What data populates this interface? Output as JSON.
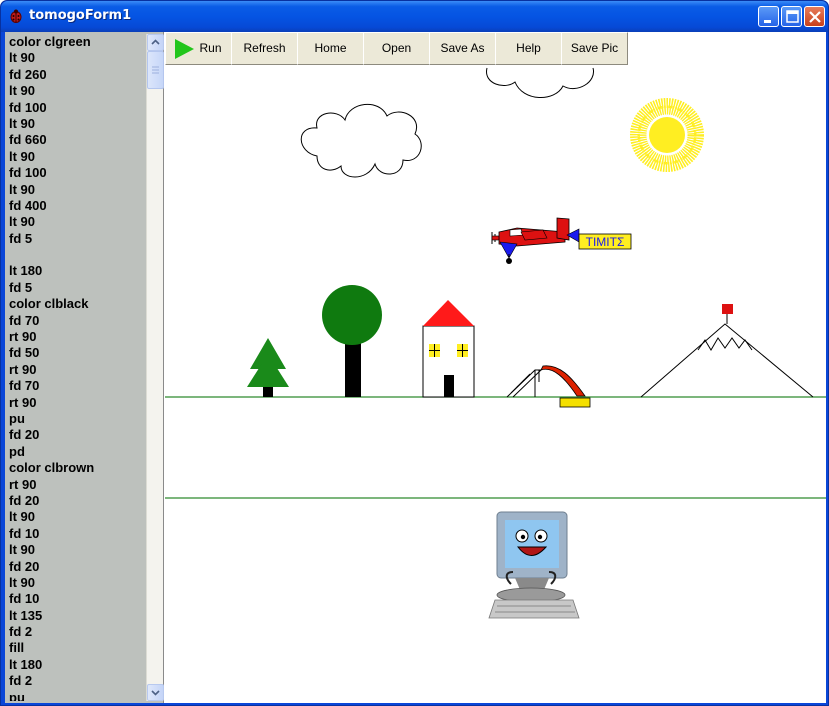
{
  "window": {
    "title": "tomogoForm1"
  },
  "code_lines": [
    "color clgreen",
    "lt 90",
    "fd 260",
    "lt 90",
    "fd 100",
    "lt 90",
    "fd 660",
    "lt 90",
    "fd 100",
    "lt 90",
    "fd 400",
    "lt 90",
    "fd 5",
    "",
    "lt 180",
    "fd 5",
    "color clblack",
    "fd 70",
    "rt 90",
    "fd 50",
    "rt 90",
    "fd 70",
    "rt 90",
    "pu",
    "fd 20",
    "pd",
    "color clbrown",
    "rt 90",
    "fd 20",
    "lt 90",
    "fd 10",
    "lt 90",
    "fd 20",
    "lt 90",
    "fd 10",
    "lt 135",
    "fd 2",
    "fill",
    "lt 180",
    "fd 2",
    "pu"
  ],
  "toolbar": {
    "run": "Run",
    "refresh": "Refresh",
    "home": "Home",
    "open": "Open",
    "save_as": "Save As",
    "help": "Help",
    "save_pic": "Save Pic"
  },
  "canvas": {
    "airplane_banner": "TIMITΣ"
  },
  "colors": {
    "ground_line": "#2e8b2e",
    "tree_green": "#1a8a1a",
    "round_tree": "#0f7a0f",
    "roof_red": "#ff1a1a",
    "sun_yellow": "#ffee22",
    "slide_red": "#dd2200",
    "slide_yellow": "#f5e000",
    "plane_red": "#dd1111",
    "plane_blue": "#1a1aee"
  },
  "icons": {
    "app": "ladybug-icon",
    "run": "play-triangle-icon",
    "minimize": "minimize-icon",
    "maximize": "maximize-icon",
    "close": "close-icon",
    "scroll_up": "scroll-up-arrow-icon",
    "scroll_down": "scroll-down-arrow-icon"
  }
}
